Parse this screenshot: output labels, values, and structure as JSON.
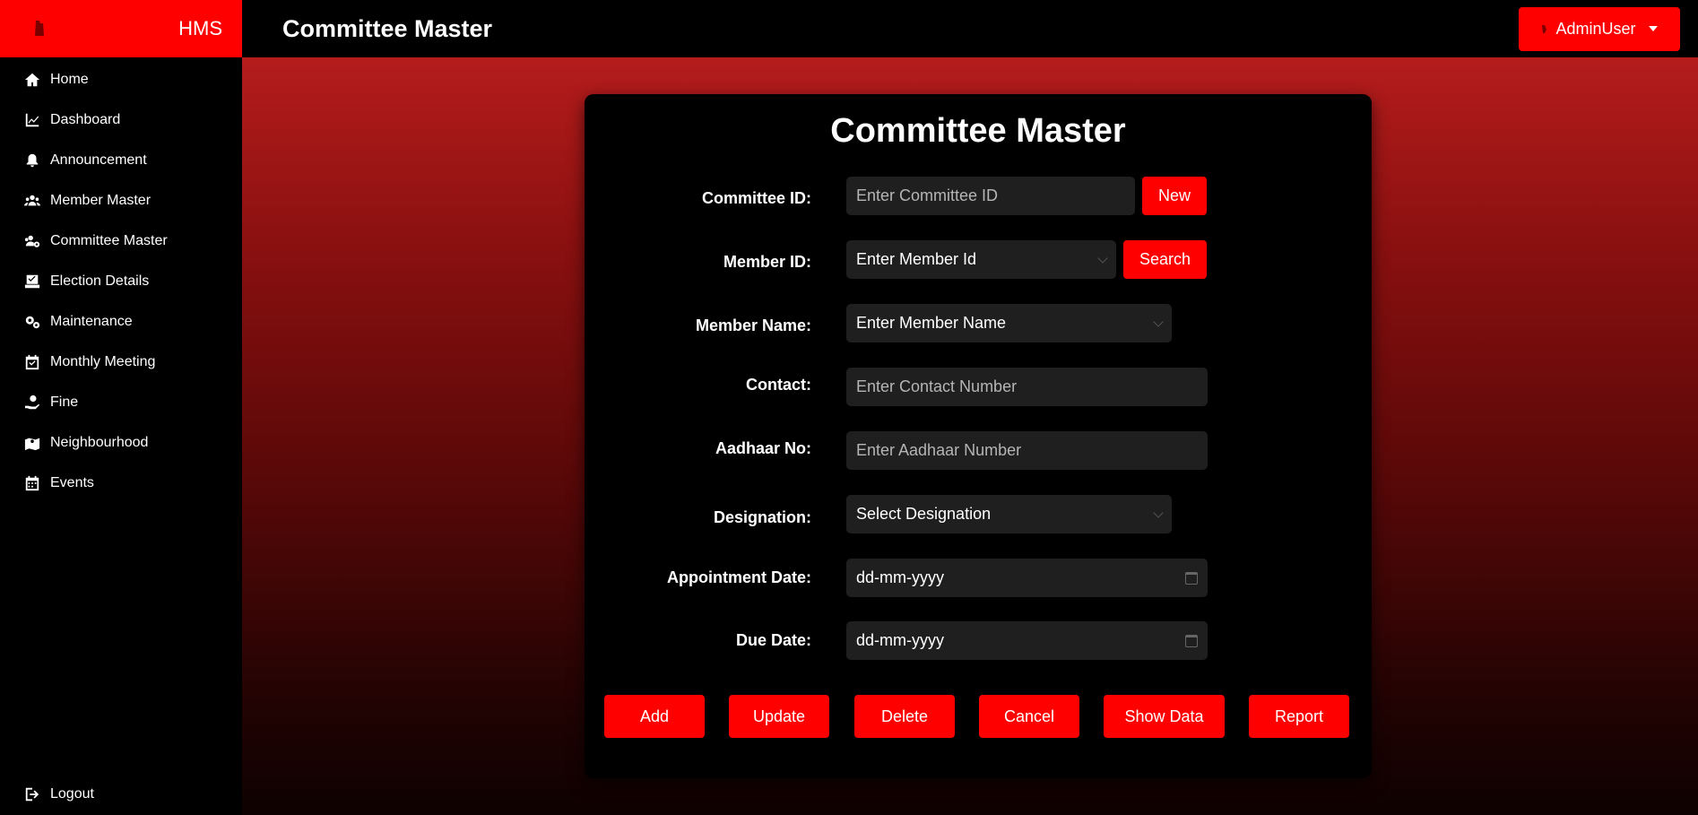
{
  "sidebar": {
    "brand": "HMS",
    "items": [
      {
        "label": "Home",
        "icon": "home-icon"
      },
      {
        "label": "Dashboard",
        "icon": "chart-line-icon"
      },
      {
        "label": "Announcement",
        "icon": "bell-icon"
      },
      {
        "label": "Member Master",
        "icon": "users-icon"
      },
      {
        "label": "Committee Master",
        "icon": "users-gear-icon"
      },
      {
        "label": "Election Details",
        "icon": "vote-icon"
      },
      {
        "label": "Maintenance",
        "icon": "gears-icon"
      },
      {
        "label": "Monthly Meeting",
        "icon": "calendar-check-icon"
      },
      {
        "label": "Fine",
        "icon": "hand-holding-dollar-icon"
      },
      {
        "label": "Neighbourhood",
        "icon": "map-location-icon"
      },
      {
        "label": "Events",
        "icon": "calendar-icon"
      }
    ],
    "logout": "Logout"
  },
  "header": {
    "title": "Committee Master",
    "user": "AdminUser"
  },
  "form": {
    "title": "Committee Master",
    "committee_id": {
      "label": "Committee ID:",
      "placeholder": "Enter Committee ID",
      "button": "New"
    },
    "member_id": {
      "label": "Member ID:",
      "value": "Enter Member Id",
      "button": "Search"
    },
    "member_name": {
      "label": "Member Name:",
      "value": "Enter Member Name"
    },
    "contact": {
      "label": "Contact:",
      "placeholder": "Enter Contact Number"
    },
    "aadhaar": {
      "label": "Aadhaar No:",
      "placeholder": "Enter Aadhaar Number"
    },
    "designation": {
      "label": "Designation:",
      "value": "Select Designation"
    },
    "appointment_date": {
      "label": "Appointment Date:",
      "value": "dd-mm-yyyy"
    },
    "due_date": {
      "label": "Due Date:",
      "value": "dd-mm-yyyy"
    }
  },
  "actions": {
    "add": "Add",
    "update": "Update",
    "delete": "Delete",
    "cancel": "Cancel",
    "show_data": "Show Data",
    "report": "Report"
  },
  "colors": {
    "accent": "#ff0000",
    "field_bg": "#1f1f1f",
    "card_bg": "#000000"
  }
}
